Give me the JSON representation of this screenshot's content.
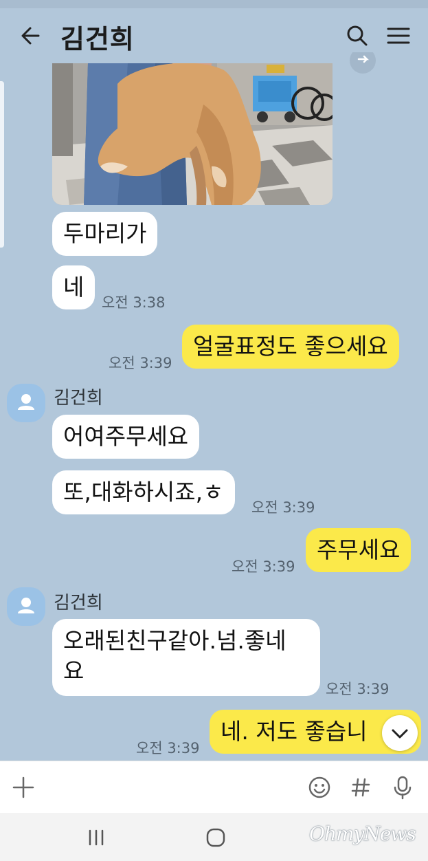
{
  "header": {
    "title": "김건희"
  },
  "photo": {
    "description_icon": "dog-photo"
  },
  "messages": [
    {
      "text": "두마리가"
    },
    {
      "text": "네",
      "time": "오전 3:38"
    },
    {
      "text": "얼굴표정도 좋으세요",
      "time": "오전 3:39"
    },
    {
      "sender": "김건희"
    },
    {
      "text": "어여주무세요"
    },
    {
      "text": "또,대화하시죠,ㅎ",
      "time": "오전 3:39"
    },
    {
      "text": "주무세요",
      "time": "오전 3:39"
    },
    {
      "sender": "김건희"
    },
    {
      "line1": "오래된친구같아.넘.좋네",
      "line2": "요",
      "time": "오전 3:39"
    },
    {
      "text": "네. 저도 좋습니",
      "time": "오전 3:39"
    }
  ],
  "watermark": "OhmyNews",
  "colors": {
    "background": "#b2c7da",
    "my_bubble": "#fbe94a",
    "their_bubble": "#ffffff",
    "avatar": "#9bc2e6"
  }
}
